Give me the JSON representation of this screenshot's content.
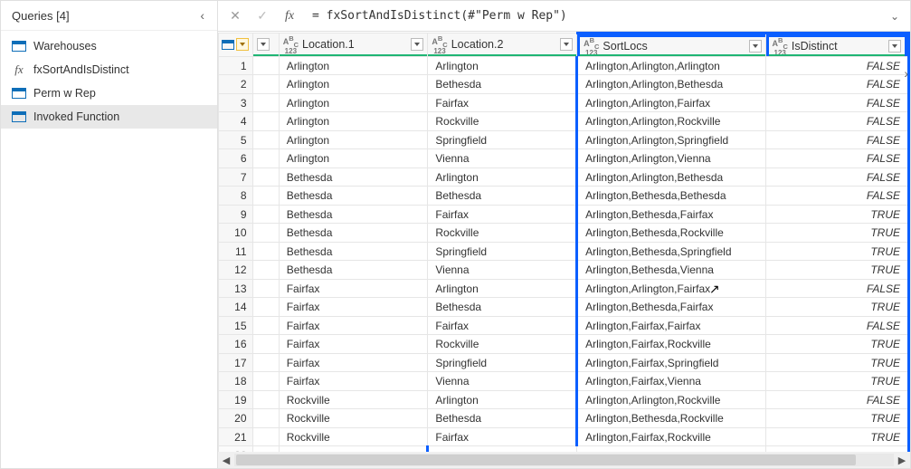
{
  "sidebar": {
    "title": "Queries [4]",
    "items": [
      {
        "label": "Warehouses",
        "type": "table"
      },
      {
        "label": "fxSortAndIsDistinct",
        "type": "fx"
      },
      {
        "label": "Perm w Rep",
        "type": "table"
      },
      {
        "label": "Invoked Function",
        "type": "table",
        "selected": true
      }
    ]
  },
  "formulaBar": {
    "value": "= fxSortAndIsDistinct(#\"Perm w Rep\")"
  },
  "columns": [
    {
      "label": "",
      "type": "corner"
    },
    {
      "label": "",
      "type": "loc0"
    },
    {
      "label": "Location.1",
      "type": "abc"
    },
    {
      "label": "Location.2",
      "type": "abc"
    },
    {
      "label": "SortLocs",
      "type": "abc",
      "hl": true
    },
    {
      "label": "IsDistinct",
      "type": "abc",
      "hl": true
    }
  ],
  "rows": [
    {
      "n": 1,
      "l1": "Arlington",
      "l2": "Arlington",
      "sl": "Arlington,Arlington,Arlington",
      "d": "FALSE"
    },
    {
      "n": 2,
      "l1": "Arlington",
      "l2": "Bethesda",
      "sl": "Arlington,Arlington,Bethesda",
      "d": "FALSE"
    },
    {
      "n": 3,
      "l1": "Arlington",
      "l2": "Fairfax",
      "sl": "Arlington,Arlington,Fairfax",
      "d": "FALSE"
    },
    {
      "n": 4,
      "l1": "Arlington",
      "l2": "Rockville",
      "sl": "Arlington,Arlington,Rockville",
      "d": "FALSE"
    },
    {
      "n": 5,
      "l1": "Arlington",
      "l2": "Springfield",
      "sl": "Arlington,Arlington,Springfield",
      "d": "FALSE"
    },
    {
      "n": 6,
      "l1": "Arlington",
      "l2": "Vienna",
      "sl": "Arlington,Arlington,Vienna",
      "d": "FALSE"
    },
    {
      "n": 7,
      "l1": "Bethesda",
      "l2": "Arlington",
      "sl": "Arlington,Arlington,Bethesda",
      "d": "FALSE"
    },
    {
      "n": 8,
      "l1": "Bethesda",
      "l2": "Bethesda",
      "sl": "Arlington,Bethesda,Bethesda",
      "d": "FALSE"
    },
    {
      "n": 9,
      "l1": "Bethesda",
      "l2": "Fairfax",
      "sl": "Arlington,Bethesda,Fairfax",
      "d": "TRUE"
    },
    {
      "n": 10,
      "l1": "Bethesda",
      "l2": "Rockville",
      "sl": "Arlington,Bethesda,Rockville",
      "d": "TRUE"
    },
    {
      "n": 11,
      "l1": "Bethesda",
      "l2": "Springfield",
      "sl": "Arlington,Bethesda,Springfield",
      "d": "TRUE"
    },
    {
      "n": 12,
      "l1": "Bethesda",
      "l2": "Vienna",
      "sl": "Arlington,Bethesda,Vienna",
      "d": "TRUE"
    },
    {
      "n": 13,
      "l1": "Fairfax",
      "l2": "Arlington",
      "sl": "Arlington,Arlington,Fairfax",
      "d": "FALSE"
    },
    {
      "n": 14,
      "l1": "Fairfax",
      "l2": "Bethesda",
      "sl": "Arlington,Bethesda,Fairfax",
      "d": "TRUE"
    },
    {
      "n": 15,
      "l1": "Fairfax",
      "l2": "Fairfax",
      "sl": "Arlington,Fairfax,Fairfax",
      "d": "FALSE"
    },
    {
      "n": 16,
      "l1": "Fairfax",
      "l2": "Rockville",
      "sl": "Arlington,Fairfax,Rockville",
      "d": "TRUE"
    },
    {
      "n": 17,
      "l1": "Fairfax",
      "l2": "Springfield",
      "sl": "Arlington,Fairfax,Springfield",
      "d": "TRUE"
    },
    {
      "n": 18,
      "l1": "Fairfax",
      "l2": "Vienna",
      "sl": "Arlington,Fairfax,Vienna",
      "d": "TRUE"
    },
    {
      "n": 19,
      "l1": "Rockville",
      "l2": "Arlington",
      "sl": "Arlington,Arlington,Rockville",
      "d": "FALSE"
    },
    {
      "n": 20,
      "l1": "Rockville",
      "l2": "Bethesda",
      "sl": "Arlington,Bethesda,Rockville",
      "d": "TRUE"
    },
    {
      "n": 21,
      "l1": "Rockville",
      "l2": "Fairfax",
      "sl": "Arlington,Fairfax,Rockville",
      "d": "TRUE"
    }
  ],
  "cursorPos": {
    "row": 13,
    "col": "sl"
  }
}
